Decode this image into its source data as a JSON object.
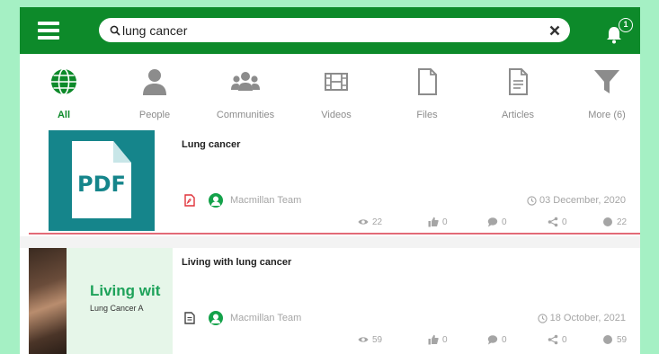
{
  "search": {
    "value": "lung cancer"
  },
  "notifications": {
    "count": "1"
  },
  "tabs": [
    {
      "label": "All"
    },
    {
      "label": "People"
    },
    {
      "label": "Communities"
    },
    {
      "label": "Videos"
    },
    {
      "label": "Files"
    },
    {
      "label": "Articles"
    },
    {
      "label": "More (6)"
    }
  ],
  "colors": {
    "brand": "#0d8a2a",
    "pdf_tile": "#15858b",
    "divider": "#e26b77"
  },
  "results": [
    {
      "title": "Lung cancer",
      "thumb_text": "PDF",
      "author": "Macmillan Team",
      "date": "03 December, 2020",
      "views": "22",
      "likes": "0",
      "comments": "0",
      "shares": "0",
      "reach": "22"
    },
    {
      "title": "Living with lung cancer",
      "thumb_title": "Living wit",
      "thumb_subtitle": "Lung Cancer A",
      "author": "Macmillan Team",
      "date": "18 October, 2021",
      "views": "59",
      "likes": "0",
      "comments": "0",
      "shares": "0",
      "reach": "59"
    }
  ]
}
